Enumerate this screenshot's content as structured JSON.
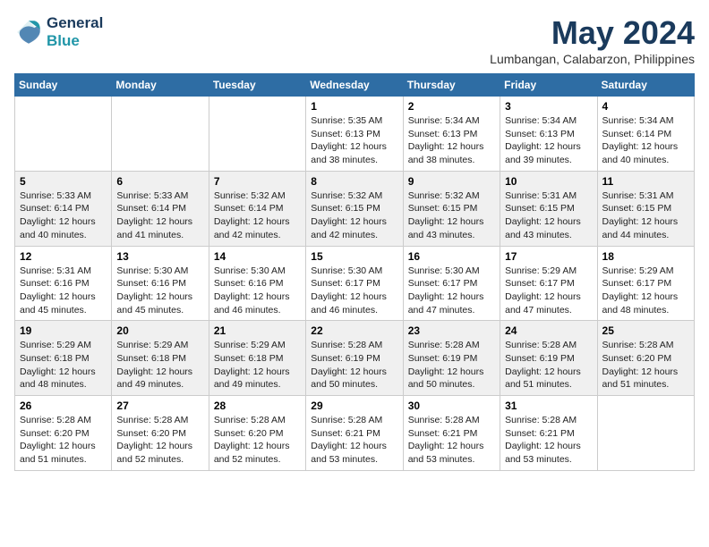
{
  "logo": {
    "line1": "General",
    "line2": "Blue"
  },
  "title": "May 2024",
  "location": "Lumbangan, Calabarzon, Philippines",
  "days_of_week": [
    "Sunday",
    "Monday",
    "Tuesday",
    "Wednesday",
    "Thursday",
    "Friday",
    "Saturday"
  ],
  "weeks": [
    [
      {
        "day": "",
        "sunrise": "",
        "sunset": "",
        "daylight": ""
      },
      {
        "day": "",
        "sunrise": "",
        "sunset": "",
        "daylight": ""
      },
      {
        "day": "",
        "sunrise": "",
        "sunset": "",
        "daylight": ""
      },
      {
        "day": "1",
        "sunrise": "Sunrise: 5:35 AM",
        "sunset": "Sunset: 6:13 PM",
        "daylight": "Daylight: 12 hours and 38 minutes."
      },
      {
        "day": "2",
        "sunrise": "Sunrise: 5:34 AM",
        "sunset": "Sunset: 6:13 PM",
        "daylight": "Daylight: 12 hours and 38 minutes."
      },
      {
        "day": "3",
        "sunrise": "Sunrise: 5:34 AM",
        "sunset": "Sunset: 6:13 PM",
        "daylight": "Daylight: 12 hours and 39 minutes."
      },
      {
        "day": "4",
        "sunrise": "Sunrise: 5:34 AM",
        "sunset": "Sunset: 6:14 PM",
        "daylight": "Daylight: 12 hours and 40 minutes."
      }
    ],
    [
      {
        "day": "5",
        "sunrise": "Sunrise: 5:33 AM",
        "sunset": "Sunset: 6:14 PM",
        "daylight": "Daylight: 12 hours and 40 minutes."
      },
      {
        "day": "6",
        "sunrise": "Sunrise: 5:33 AM",
        "sunset": "Sunset: 6:14 PM",
        "daylight": "Daylight: 12 hours and 41 minutes."
      },
      {
        "day": "7",
        "sunrise": "Sunrise: 5:32 AM",
        "sunset": "Sunset: 6:14 PM",
        "daylight": "Daylight: 12 hours and 42 minutes."
      },
      {
        "day": "8",
        "sunrise": "Sunrise: 5:32 AM",
        "sunset": "Sunset: 6:15 PM",
        "daylight": "Daylight: 12 hours and 42 minutes."
      },
      {
        "day": "9",
        "sunrise": "Sunrise: 5:32 AM",
        "sunset": "Sunset: 6:15 PM",
        "daylight": "Daylight: 12 hours and 43 minutes."
      },
      {
        "day": "10",
        "sunrise": "Sunrise: 5:31 AM",
        "sunset": "Sunset: 6:15 PM",
        "daylight": "Daylight: 12 hours and 43 minutes."
      },
      {
        "day": "11",
        "sunrise": "Sunrise: 5:31 AM",
        "sunset": "Sunset: 6:15 PM",
        "daylight": "Daylight: 12 hours and 44 minutes."
      }
    ],
    [
      {
        "day": "12",
        "sunrise": "Sunrise: 5:31 AM",
        "sunset": "Sunset: 6:16 PM",
        "daylight": "Daylight: 12 hours and 45 minutes."
      },
      {
        "day": "13",
        "sunrise": "Sunrise: 5:30 AM",
        "sunset": "Sunset: 6:16 PM",
        "daylight": "Daylight: 12 hours and 45 minutes."
      },
      {
        "day": "14",
        "sunrise": "Sunrise: 5:30 AM",
        "sunset": "Sunset: 6:16 PM",
        "daylight": "Daylight: 12 hours and 46 minutes."
      },
      {
        "day": "15",
        "sunrise": "Sunrise: 5:30 AM",
        "sunset": "Sunset: 6:17 PM",
        "daylight": "Daylight: 12 hours and 46 minutes."
      },
      {
        "day": "16",
        "sunrise": "Sunrise: 5:30 AM",
        "sunset": "Sunset: 6:17 PM",
        "daylight": "Daylight: 12 hours and 47 minutes."
      },
      {
        "day": "17",
        "sunrise": "Sunrise: 5:29 AM",
        "sunset": "Sunset: 6:17 PM",
        "daylight": "Daylight: 12 hours and 47 minutes."
      },
      {
        "day": "18",
        "sunrise": "Sunrise: 5:29 AM",
        "sunset": "Sunset: 6:17 PM",
        "daylight": "Daylight: 12 hours and 48 minutes."
      }
    ],
    [
      {
        "day": "19",
        "sunrise": "Sunrise: 5:29 AM",
        "sunset": "Sunset: 6:18 PM",
        "daylight": "Daylight: 12 hours and 48 minutes."
      },
      {
        "day": "20",
        "sunrise": "Sunrise: 5:29 AM",
        "sunset": "Sunset: 6:18 PM",
        "daylight": "Daylight: 12 hours and 49 minutes."
      },
      {
        "day": "21",
        "sunrise": "Sunrise: 5:29 AM",
        "sunset": "Sunset: 6:18 PM",
        "daylight": "Daylight: 12 hours and 49 minutes."
      },
      {
        "day": "22",
        "sunrise": "Sunrise: 5:28 AM",
        "sunset": "Sunset: 6:19 PM",
        "daylight": "Daylight: 12 hours and 50 minutes."
      },
      {
        "day": "23",
        "sunrise": "Sunrise: 5:28 AM",
        "sunset": "Sunset: 6:19 PM",
        "daylight": "Daylight: 12 hours and 50 minutes."
      },
      {
        "day": "24",
        "sunrise": "Sunrise: 5:28 AM",
        "sunset": "Sunset: 6:19 PM",
        "daylight": "Daylight: 12 hours and 51 minutes."
      },
      {
        "day": "25",
        "sunrise": "Sunrise: 5:28 AM",
        "sunset": "Sunset: 6:20 PM",
        "daylight": "Daylight: 12 hours and 51 minutes."
      }
    ],
    [
      {
        "day": "26",
        "sunrise": "Sunrise: 5:28 AM",
        "sunset": "Sunset: 6:20 PM",
        "daylight": "Daylight: 12 hours and 51 minutes."
      },
      {
        "day": "27",
        "sunrise": "Sunrise: 5:28 AM",
        "sunset": "Sunset: 6:20 PM",
        "daylight": "Daylight: 12 hours and 52 minutes."
      },
      {
        "day": "28",
        "sunrise": "Sunrise: 5:28 AM",
        "sunset": "Sunset: 6:20 PM",
        "daylight": "Daylight: 12 hours and 52 minutes."
      },
      {
        "day": "29",
        "sunrise": "Sunrise: 5:28 AM",
        "sunset": "Sunset: 6:21 PM",
        "daylight": "Daylight: 12 hours and 53 minutes."
      },
      {
        "day": "30",
        "sunrise": "Sunrise: 5:28 AM",
        "sunset": "Sunset: 6:21 PM",
        "daylight": "Daylight: 12 hours and 53 minutes."
      },
      {
        "day": "31",
        "sunrise": "Sunrise: 5:28 AM",
        "sunset": "Sunset: 6:21 PM",
        "daylight": "Daylight: 12 hours and 53 minutes."
      },
      {
        "day": "",
        "sunrise": "",
        "sunset": "",
        "daylight": ""
      }
    ]
  ]
}
